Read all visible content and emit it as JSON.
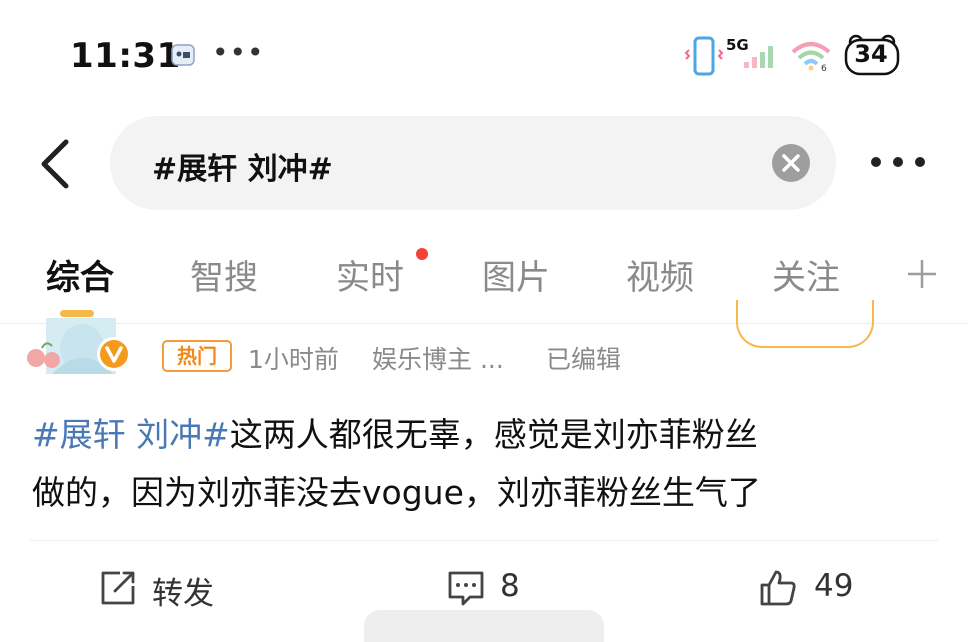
{
  "status_bar": {
    "time": "11:31",
    "dots": "•••",
    "network": "5G",
    "battery": "34"
  },
  "search": {
    "query": "#展轩 刘冲#"
  },
  "tabs": [
    {
      "label": "综合",
      "active": true
    },
    {
      "label": "智搜",
      "active": false
    },
    {
      "label": "实时",
      "active": false,
      "has_dot": true
    },
    {
      "label": "图片",
      "active": false
    },
    {
      "label": "视频",
      "active": false
    },
    {
      "label": "关注",
      "active": false
    }
  ],
  "post": {
    "hot_label": "热门",
    "time": "1小时前",
    "source": "娱乐博主 ...",
    "edited": "已编辑",
    "hashtag": "#展轩 刘冲#",
    "text_line1": "这两人都很无辜，感觉是刘亦菲粉丝",
    "text_line2": "做的，因为刘亦菲没去vogue，刘亦菲粉丝生气了",
    "actions": {
      "repost_label": "转发",
      "comment_count": "8",
      "like_count": "49"
    }
  },
  "colors": {
    "accent": "#f7b84a",
    "hashtag": "#4a78b5",
    "hot": "#f08a1e",
    "red_dot": "#f44336"
  }
}
